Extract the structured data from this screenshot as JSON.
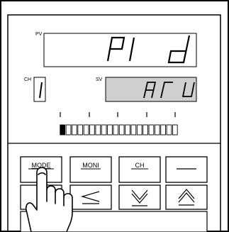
{
  "display": {
    "pv": {
      "label": "PV",
      "value": "PId"
    },
    "sv": {
      "label": "SV",
      "value": "ArU"
    },
    "ch": {
      "label": "CH",
      "value": "1"
    }
  },
  "bargraph": {
    "segments": 20,
    "lit": 1
  },
  "keys": {
    "mode": "MODE",
    "moni": "MONI",
    "ch": "CH",
    "blank": "",
    "left_arrow": "left-arrow",
    "down_arrow": "down-arrow",
    "up_arrow": "up-arrow"
  },
  "colors": {
    "sv_fill": "#cfcfcf",
    "panel_fill": "#ffffff",
    "stroke": "#000000"
  }
}
